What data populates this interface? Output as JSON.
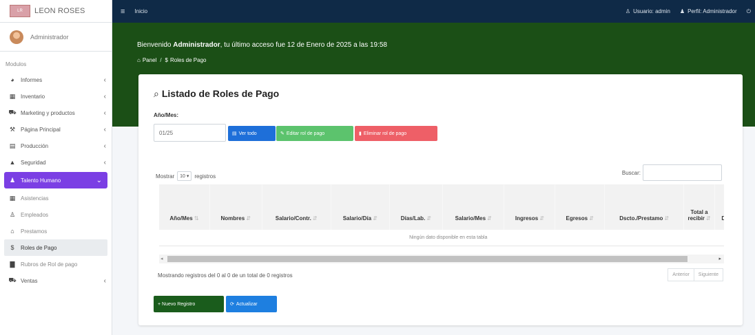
{
  "brand": {
    "name": "LEON ROSES",
    "logo_text": "LR"
  },
  "user": {
    "name": "Administrador"
  },
  "sidebar": {
    "header": "Modulos",
    "items": [
      {
        "icon": "chart-icon",
        "glyph": "◕",
        "label": "Informes",
        "arrow": "‹"
      },
      {
        "icon": "boxes-icon",
        "glyph": "▦",
        "label": "Inventario",
        "arrow": "‹"
      },
      {
        "icon": "cart-icon",
        "glyph": "⛟",
        "label": "Marketing y productos",
        "arrow": "‹"
      },
      {
        "icon": "sitemap-icon",
        "glyph": "⚒",
        "label": "Página Principal",
        "arrow": "‹"
      },
      {
        "icon": "calendar-icon",
        "glyph": "▤",
        "label": "Producción",
        "arrow": "‹"
      },
      {
        "icon": "lock-icon",
        "glyph": "▲",
        "label": "Seguridad",
        "arrow": "‹"
      },
      {
        "icon": "users-icon",
        "glyph": "♟",
        "label": "Talento Humano",
        "arrow": "⌄"
      },
      {
        "icon": "grid-icon",
        "glyph": "▦",
        "label": "Asistencias",
        "arrow": ""
      },
      {
        "icon": "person-icon",
        "glyph": "♙",
        "label": "Empleados",
        "arrow": ""
      },
      {
        "icon": "bank-icon",
        "glyph": "⌂",
        "label": "Prestamos",
        "arrow": ""
      },
      {
        "icon": "dollar-icon",
        "glyph": "$",
        "label": "Roles de Pago",
        "arrow": ""
      },
      {
        "icon": "file-icon",
        "glyph": "▇",
        "label": "Rubros de Rol de pago",
        "arrow": ""
      },
      {
        "icon": "truck-icon",
        "glyph": "⛟",
        "label": "Ventas",
        "arrow": "‹"
      }
    ]
  },
  "topbar": {
    "menu_label": "Inicio",
    "user_link": "Usuario: admin",
    "profile_link": "Perfil: Administrador"
  },
  "hero": {
    "welcome_prefix": "Bienvenido ",
    "welcome_name": "Administrador",
    "welcome_suffix": ", tu último acceso fue 12 de Enero de 2025 a las 19:58",
    "breadcrumb_home": "Panel",
    "breadcrumb_current": "Roles de Pago"
  },
  "card": {
    "title": "Listado de Roles de Pago",
    "month_label": "Año/Mes:",
    "month_value": "01/25",
    "btn_ver": "Ver todo",
    "btn_editar": "Editar rol de pago",
    "btn_eliminar": "Eliminar rol de pago",
    "show_prefix": "Mostrar",
    "show_value": "10",
    "show_suffix": "registros",
    "search_label": "Buscar:",
    "columns": [
      "Año/Mes",
      "Nombres",
      "Salario/Contr.",
      "Salario/Día",
      "Días/Lab.",
      "Salario/Mes",
      "Ingresos",
      "Egresos",
      "Dscto./Prestamo",
      "Total a recibir",
      "Det"
    ],
    "empty_message": "Ningún dato disponible en esta tabla",
    "info": "Mostrando registros del 0 al 0 de un total de 0 registros",
    "prev": "Anterior",
    "next": "Siguiente",
    "btn_nuevo": "+ Nuevo Registro",
    "btn_actualizar": "Actualizar"
  }
}
